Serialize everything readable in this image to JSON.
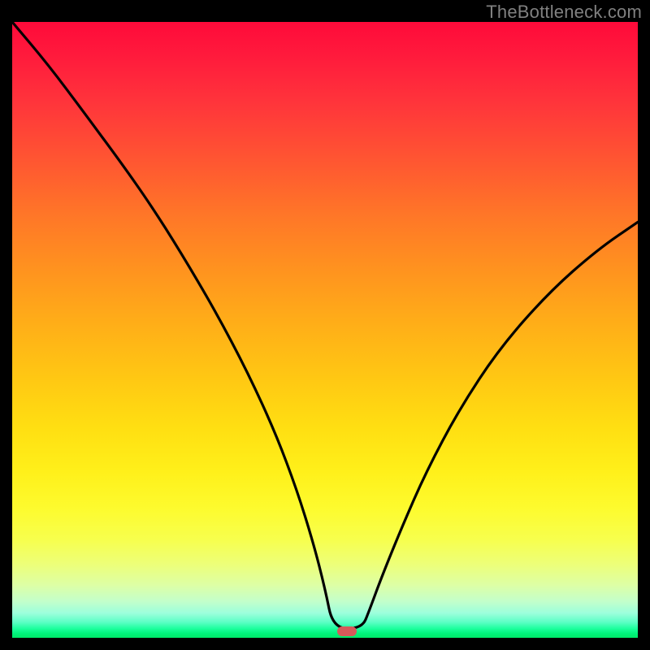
{
  "watermark": "TheBottleneck.com",
  "colors": {
    "frame": "#000000",
    "curve": "#000000",
    "marker": "#d65a5a",
    "watermark": "#808080"
  },
  "chart_data": {
    "type": "line",
    "title": "",
    "xlabel": "",
    "ylabel": "",
    "xlim": [
      0,
      100
    ],
    "ylim": [
      0,
      100
    ],
    "grid": false,
    "background": "rainbow-gradient-vertical",
    "annotations": [
      {
        "kind": "marker",
        "shape": "pill",
        "x": 53.5,
        "y": 1.0,
        "color": "#d65a5a"
      }
    ],
    "series": [
      {
        "name": "bottleneck-curve",
        "color": "#000000",
        "x": [
          0.0,
          5.8,
          11.7,
          17.5,
          22.0,
          27.0,
          32.5,
          37.7,
          42.2,
          45.5,
          48.1,
          50.0,
          51.3,
          55.9,
          57.1,
          59.1,
          62.3,
          66.2,
          71.4,
          77.9,
          85.7,
          93.5,
          100.0
        ],
        "y": [
          100.0,
          93.0,
          85.0,
          77.0,
          70.5,
          62.5,
          53.0,
          43.0,
          33.0,
          24.0,
          15.5,
          8.0,
          1.5,
          1.5,
          4.5,
          10.0,
          18.0,
          27.0,
          37.0,
          47.0,
          56.0,
          63.0,
          67.5
        ]
      }
    ]
  }
}
